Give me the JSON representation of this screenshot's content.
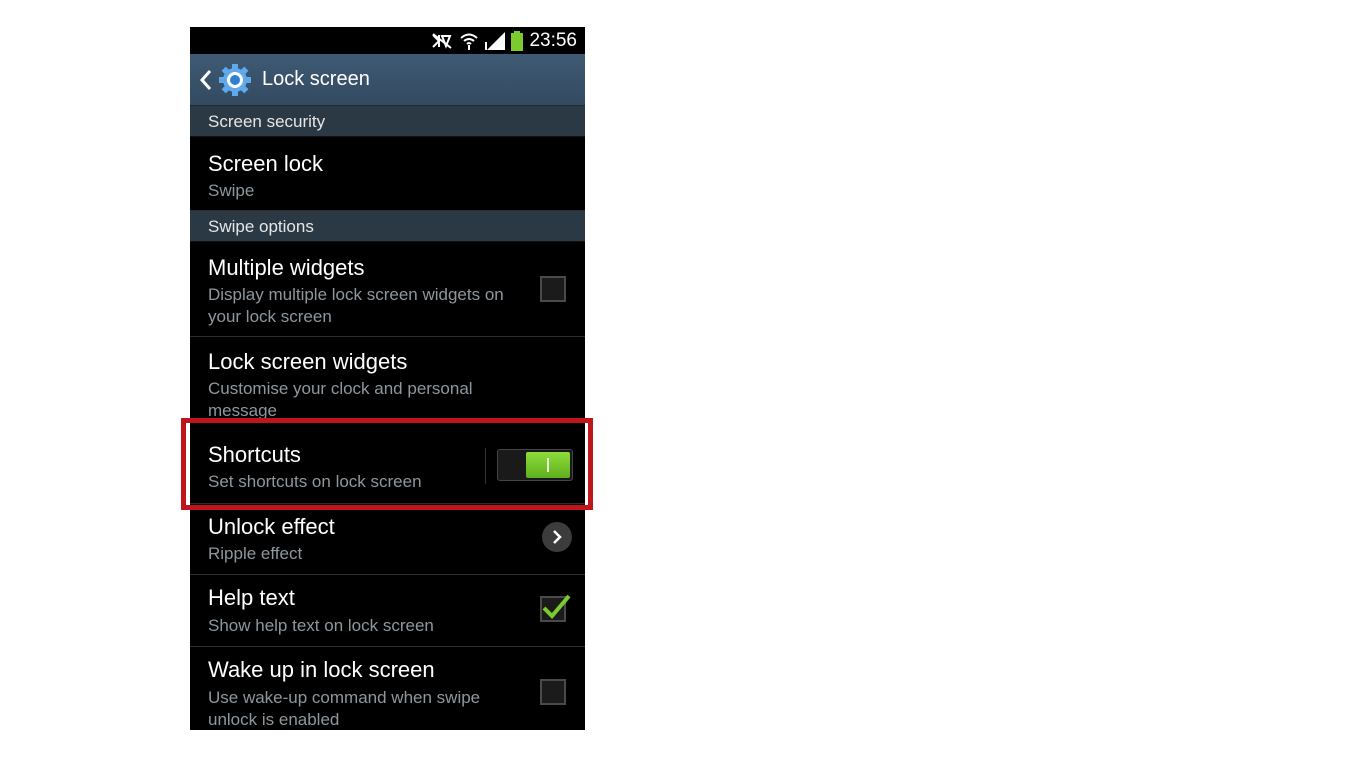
{
  "status_bar": {
    "time": "23:56",
    "icons": [
      "mute-icon",
      "wifi-icon",
      "signal-icon",
      "battery-icon"
    ]
  },
  "action_bar": {
    "title": "Lock screen",
    "back_icon": "chevron-left-icon",
    "app_icon": "gear-icon"
  },
  "sections": {
    "screen_security": "Screen security",
    "swipe_options": "Swipe options"
  },
  "items": {
    "screen_lock": {
      "title": "Screen lock",
      "subtitle": "Swipe"
    },
    "multiple_widgets": {
      "title": "Multiple widgets",
      "subtitle": "Display multiple lock screen widgets on your lock screen",
      "checked": false
    },
    "lock_screen_widgets": {
      "title": "Lock screen widgets",
      "subtitle": "Customise your clock and personal message"
    },
    "shortcuts": {
      "title": "Shortcuts",
      "subtitle": "Set shortcuts on lock screen",
      "toggle_on": true
    },
    "unlock_effect": {
      "title": "Unlock effect",
      "subtitle": "Ripple effect"
    },
    "help_text": {
      "title": "Help text",
      "subtitle": "Show help text on lock screen",
      "checked": true
    },
    "wake_up": {
      "title": "Wake up in lock screen",
      "subtitle": "Use wake-up command when swipe unlock is enabled",
      "checked": false
    }
  },
  "colors": {
    "action_bar": "#3a5269",
    "section_header": "#2b3944",
    "toggle_on": "#7ccb2e",
    "checkmark": "#7ccb2e",
    "highlight": "#c0151b"
  }
}
